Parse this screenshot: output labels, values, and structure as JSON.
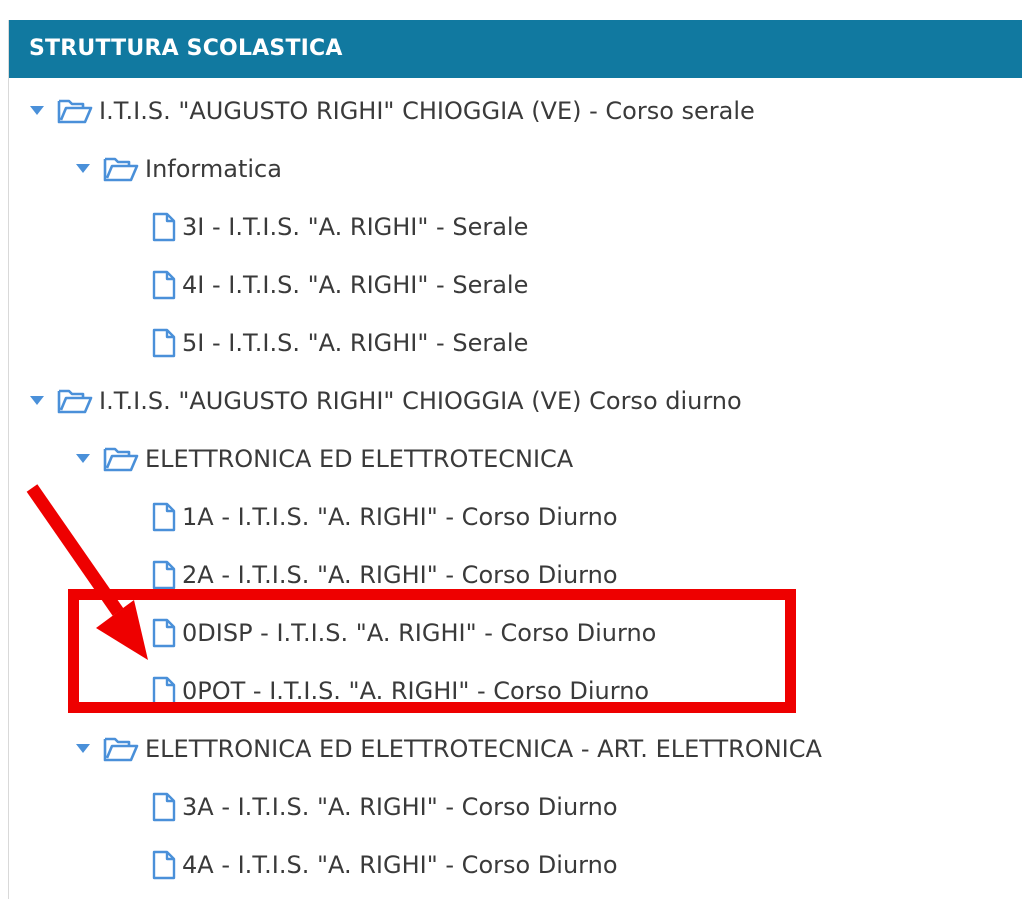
{
  "panel": {
    "title": "STRUTTURA SCOLASTICA"
  },
  "tree": {
    "schools": [
      {
        "label": "I.T.I.S. \"AUGUSTO RIGHI\" CHIOGGIA (VE) - Corso serale",
        "expanded": true,
        "courses": [
          {
            "label": "Informatica",
            "expanded": true,
            "classes": [
              "3I - I.T.I.S. \"A. RIGHI\" - Serale",
              "4I - I.T.I.S. \"A. RIGHI\" - Serale",
              "5I - I.T.I.S. \"A. RIGHI\" - Serale"
            ]
          }
        ]
      },
      {
        "label": "I.T.I.S. \"AUGUSTO RIGHI\" CHIOGGIA (VE) Corso diurno",
        "expanded": true,
        "courses": [
          {
            "label": "ELETTRONICA ED ELETTROTECNICA",
            "expanded": true,
            "classes": [
              "1A - I.T.I.S. \"A. RIGHI\" - Corso Diurno",
              "2A - I.T.I.S. \"A. RIGHI\" - Corso Diurno",
              "0DISP - I.T.I.S. \"A. RIGHI\" - Corso Diurno",
              "0POT - I.T.I.S. \"A. RIGHI\" - Corso Diurno"
            ]
          },
          {
            "label": "ELETTRONICA ED ELETTROTECNICA - ART. ELETTRONICA",
            "expanded": true,
            "classes": [
              "3A - I.T.I.S. \"A. RIGHI\" - Corso Diurno",
              "4A - I.T.I.S. \"A. RIGHI\" - Corso Diurno"
            ]
          }
        ]
      }
    ]
  },
  "colors": {
    "header_bg": "#1179a0",
    "icon_blue": "#4a90d9",
    "annotation_red": "#ee0000"
  },
  "icons": {
    "expander": "caret-down-icon",
    "folder": "folder-open-icon",
    "file": "file-icon"
  }
}
